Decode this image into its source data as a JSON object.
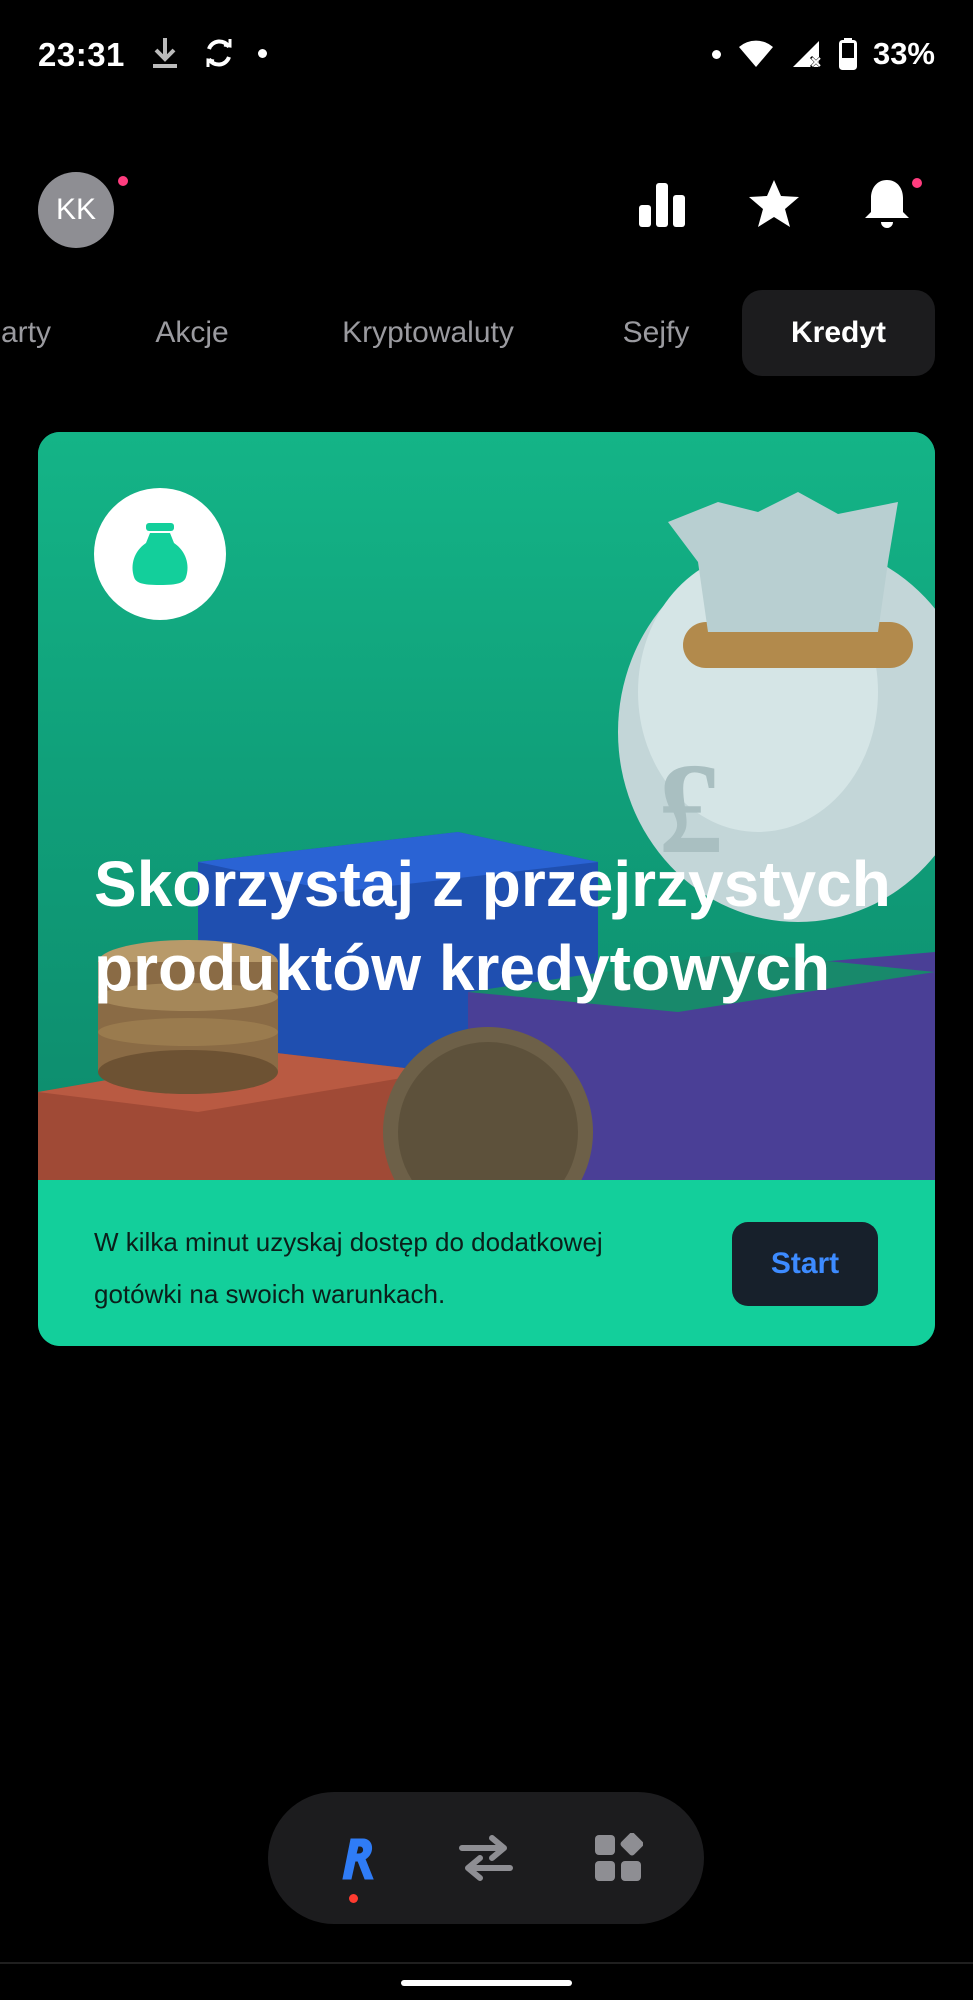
{
  "status_bar": {
    "time": "23:31",
    "battery": "33%",
    "icons": [
      "download-icon",
      "sync-icon",
      "dot",
      "dot",
      "wifi-icon",
      "signal-icon",
      "battery-icon"
    ]
  },
  "header": {
    "avatar_initials": "KK",
    "icons": [
      "chart-icon",
      "star-icon",
      "bell-icon"
    ]
  },
  "tabs": [
    {
      "label": "arty",
      "active": false
    },
    {
      "label": "Akcje",
      "active": false
    },
    {
      "label": "Kryptowaluty",
      "active": false
    },
    {
      "label": "Sejfy",
      "active": false
    },
    {
      "label": "Kredyt",
      "active": true
    }
  ],
  "card": {
    "title": "Skorzystaj z przejrzystych produktów kredytowych",
    "description": "W kilka minut uzyskaj dostęp do dodatkowej gotówki na swoich warunkach.",
    "button_label": "Start",
    "icon": "money-bag-icon"
  },
  "bottom_nav": {
    "items": [
      "home-r-icon",
      "transfer-icon",
      "apps-icon"
    ]
  },
  "colors": {
    "accent": "#13cf9b",
    "button_bg": "#17202b",
    "button_text": "#3d8bff",
    "notification": "#ff3d7f"
  }
}
